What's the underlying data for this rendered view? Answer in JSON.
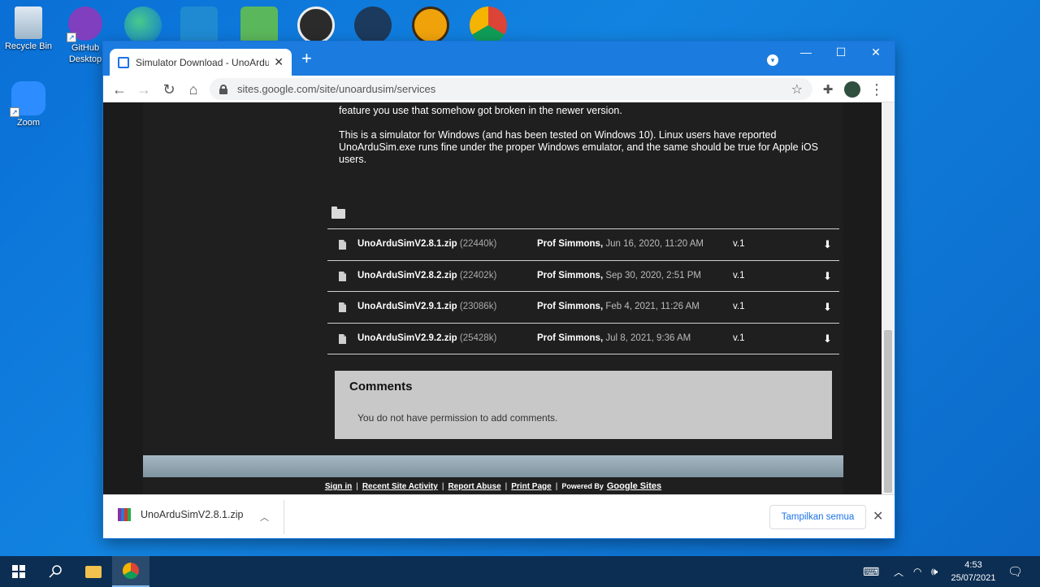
{
  "desktop": {
    "icons": [
      {
        "label": "Recycle Bin"
      },
      {
        "label": "GitHub Desktop"
      },
      {
        "label": "Zoom"
      }
    ]
  },
  "browser": {
    "tab_title": "Simulator Download - UnoArduSim",
    "url": "sites.google.com/site/unoardusim/services"
  },
  "page": {
    "para1": "feature you use that somehow got broken in the newer version.",
    "para2": "This is a simulator for Windows (and has been tested on Windows 10). Linux users have reported UnoArduSim.exe runs fine under the proper Windows emulator, and the same should be true for Apple iOS users.",
    "files": [
      {
        "name": "UnoArduSimV2.8.1.zip",
        "size": "(22440k)",
        "author": "Prof Simmons,",
        "date": "Jun 16, 2020, 11:20 AM",
        "version": "v.1"
      },
      {
        "name": "UnoArduSimV2.8.2.zip",
        "size": "(22402k)",
        "author": "Prof Simmons,",
        "date": "Sep 30, 2020, 2:51 PM",
        "version": "v.1"
      },
      {
        "name": "UnoArduSimV2.9.1.zip",
        "size": "(23086k)",
        "author": "Prof Simmons,",
        "date": "Feb 4, 2021, 11:26 AM",
        "version": "v.1"
      },
      {
        "name": "UnoArduSimV2.9.2.zip",
        "size": "(25428k)",
        "author": "Prof Simmons,",
        "date": "Jul 8, 2021, 9:36 AM",
        "version": "v.1"
      }
    ],
    "comments_title": "Comments",
    "comments_text": "You do not have permission to add comments.",
    "footer": {
      "sign_in": "Sign in",
      "recent": "Recent Site Activity",
      "report": "Report Abuse",
      "print": "Print Page",
      "powered": "Powered By",
      "google_sites": "Google Sites"
    }
  },
  "download_shelf": {
    "file": "UnoArduSimV2.8.1.zip",
    "show_all": "Tampilkan semua"
  },
  "taskbar": {
    "time": "4:53",
    "date": "25/07/2021"
  }
}
